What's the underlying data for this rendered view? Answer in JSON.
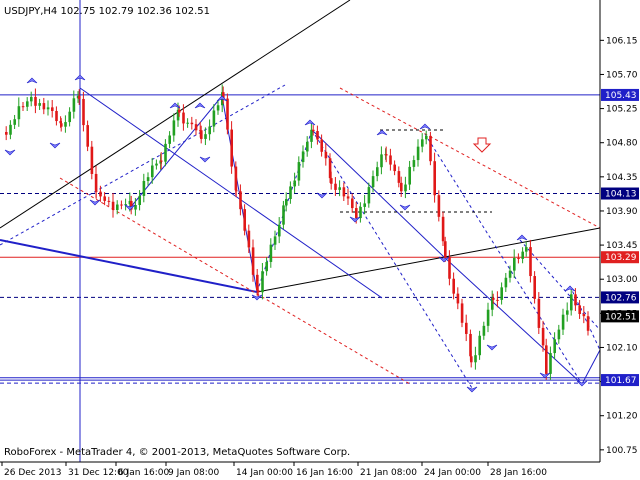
{
  "window": {
    "header": "USDJPY,H4  102.75 102.79 102.36 102.51",
    "copyright": "RoboForex - MetaTrader 4, © 2001-2013, MetaQuotes Software Corp."
  },
  "chart_data": {
    "type": "candlestick",
    "symbol": "USDJPY",
    "timeframe": "H4",
    "ohlc_last": {
      "open": 102.75,
      "high": 102.79,
      "low": 102.36,
      "close": 102.51
    },
    "ylim": [
      100.55,
      106.55
    ],
    "y_ticks": [
      "106.15",
      "105.70",
      "105.25",
      "104.80",
      "104.35",
      "103.90",
      "103.45",
      "103.00",
      "102.55",
      "102.10",
      "101.65",
      "101.20",
      "100.75"
    ],
    "x_ticks": [
      "26 Dec 2013",
      "31 Dec 12:00",
      "6 Jan 16:00",
      "9 Jan 08:00",
      "14 Jan 00:00",
      "16 Jan 16:00",
      "21 Jan 08:00",
      "24 Jan 00:00",
      "28 Jan 16:00"
    ],
    "horizontal_levels": [
      {
        "label": "105.43",
        "value": 105.43,
        "color": "#2020c8",
        "style": "solid"
      },
      {
        "label": "104.13",
        "value": 104.13,
        "color": "#000080",
        "style": "dashed"
      },
      {
        "label": "103.29",
        "value": 103.29,
        "color": "#e02020",
        "style": "solid"
      },
      {
        "label": "102.76",
        "value": 102.76,
        "color": "#000080",
        "style": "dashed"
      },
      {
        "label": "102.51",
        "value": 102.51,
        "color": "#000000",
        "style": "price"
      },
      {
        "label": "101.67",
        "value": 101.67,
        "color": "#2020c8",
        "style": "solid"
      }
    ],
    "colors": {
      "bull": "#22a022",
      "bear": "#e01818",
      "line": "#2020c8",
      "red": "#e02020"
    }
  }
}
